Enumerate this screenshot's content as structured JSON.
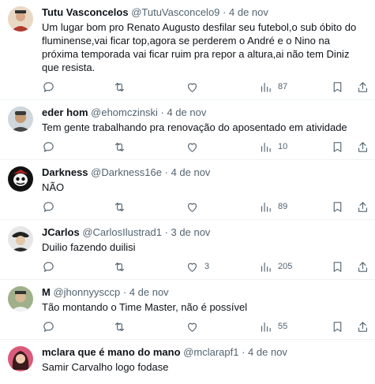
{
  "tweets": [
    {
      "name": "Tutu Vasconcelos",
      "handle": "@TutuVasconcelo9",
      "sep": "·",
      "date": "4 de nov",
      "text": "Um lugar bom pro Renato Augusto desfilar seu futebol,o sub óbito do fluminense,vai ficar top,agora se perderem o André e o Nino na próxima temporada vai ficar ruim pra repor a altura,ai não tem Diniz que resista.",
      "replies": "",
      "retweets": "",
      "likes": "",
      "views": "87",
      "avatar_colors": [
        "#c0392b",
        "#e8c9a0"
      ]
    },
    {
      "name": "eder hom",
      "handle": "@ehomczinski",
      "sep": "·",
      "date": "4 de nov",
      "text": "Tem gente trabalhando pra renovação do aposentado em atividade",
      "replies": "",
      "retweets": "",
      "likes": "",
      "views": "10",
      "avatar_colors": [
        "#4a4a4a",
        "#d9b38c"
      ]
    },
    {
      "name": "Darkness",
      "handle": "@Darkness16e",
      "sep": "·",
      "date": "4 de nov",
      "text": "NÃO",
      "replies": "",
      "retweets": "",
      "likes": "",
      "views": "89",
      "avatar_colors": [
        "#111111",
        "#f2f2f2"
      ]
    },
    {
      "name": "JCarlos",
      "handle": "@CarlosIlustrad1",
      "sep": "·",
      "date": "3 de nov",
      "text": "Duilio fazendo duilisi",
      "replies": "",
      "retweets": "",
      "likes": "3",
      "views": "205",
      "avatar_colors": [
        "#2b2b2b",
        "#e7d5c0"
      ]
    },
    {
      "name": "M",
      "handle": "@jhonnyysccp",
      "sep": "·",
      "date": "4 de nov",
      "text": "Tão montando o Time Master, não é possível",
      "replies": "",
      "retweets": "",
      "likes": "",
      "views": "55",
      "avatar_colors": [
        "#7a8a6a",
        "#d8c4a8"
      ]
    },
    {
      "name": "mclara que é mano do mano",
      "handle": "@mclarapf1",
      "sep": "·",
      "date": "4 de nov",
      "text": "Samir Carvalho logo fodase",
      "replies": "",
      "retweets": "",
      "likes": "",
      "views": "",
      "avatar_colors": [
        "#c23a5a",
        "#f0c8b0"
      ]
    }
  ],
  "icons": {
    "reply": "reply-icon",
    "retweet": "retweet-icon",
    "like": "like-icon",
    "views": "views-icon",
    "bookmark": "bookmark-icon",
    "share": "share-icon"
  }
}
